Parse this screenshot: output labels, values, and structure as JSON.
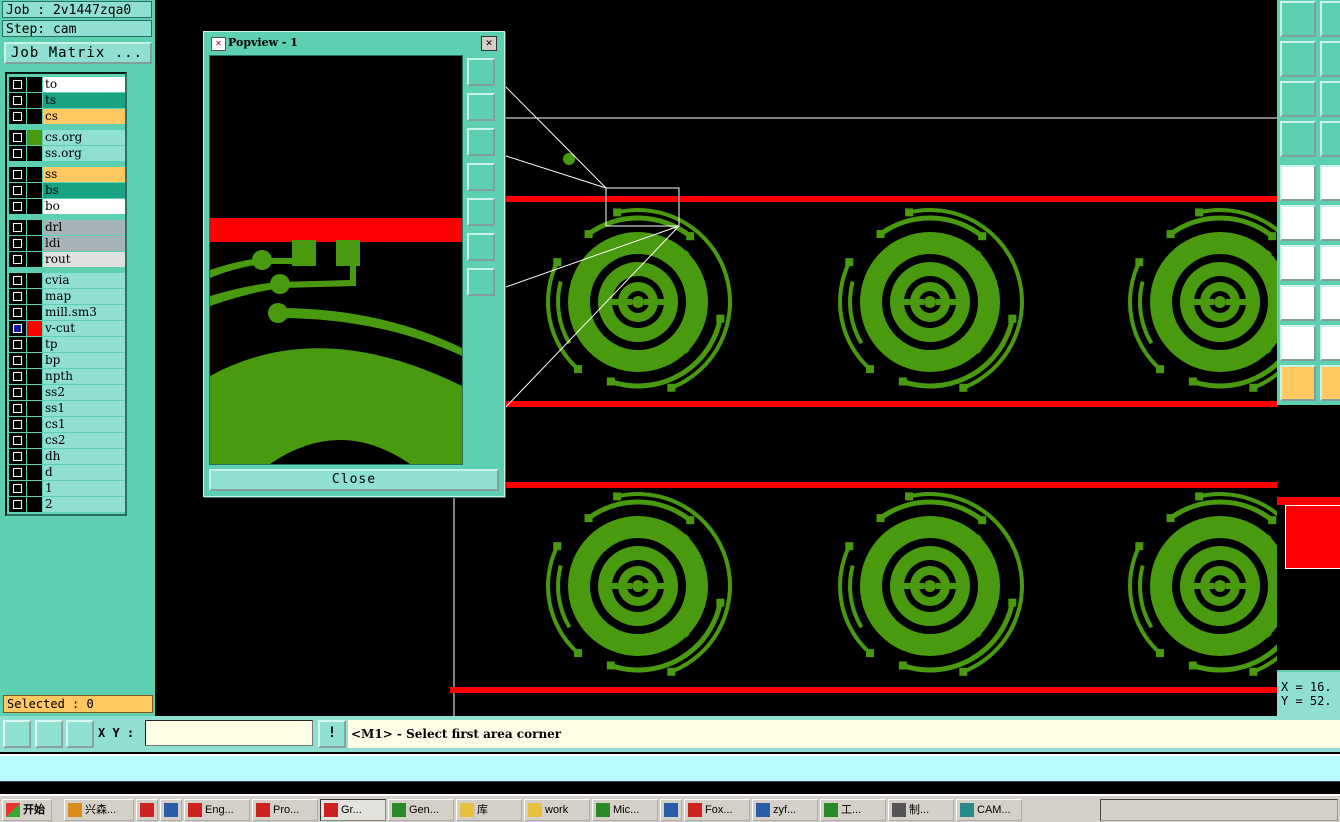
{
  "job": {
    "label": "Job : 2v1447zqa0",
    "step": "Step: cam",
    "matrix_button": "Job Matrix ..."
  },
  "layers": [
    {
      "name": "to",
      "color": "#ffffff"
    },
    {
      "name": "ts",
      "color": "#1aa383"
    },
    {
      "name": "cs",
      "color": "#ffc860"
    },
    {
      "name": "cs.org",
      "color": "#8fe0d2",
      "swatch": "#4a9a10"
    },
    {
      "name": "ss.org",
      "color": "#8fe0d2"
    },
    {
      "name": "ss",
      "color": "#ffc860"
    },
    {
      "name": "bs",
      "color": "#1aa383"
    },
    {
      "name": "bo",
      "color": "#ffffff"
    },
    {
      "name": "drl",
      "color": "#a6b4b8"
    },
    {
      "name": "ldi",
      "color": "#a6b4b8"
    },
    {
      "name": "rout",
      "color": "#e0e0e0"
    },
    {
      "name": "cvia",
      "color": "#8fe0d2"
    },
    {
      "name": "map",
      "color": "#8fe0d2"
    },
    {
      "name": "mill.sm3",
      "color": "#8fe0d2"
    },
    {
      "name": "v-cut",
      "color": "#8fe0d2",
      "swatch": "#ff0000",
      "on": true
    },
    {
      "name": "tp",
      "color": "#8fe0d2"
    },
    {
      "name": "bp",
      "color": "#8fe0d2"
    },
    {
      "name": "npth",
      "color": "#8fe0d2"
    },
    {
      "name": "ss2",
      "color": "#8fe0d2"
    },
    {
      "name": "ss1",
      "color": "#8fe0d2"
    },
    {
      "name": "cs1",
      "color": "#8fe0d2"
    },
    {
      "name": "cs2",
      "color": "#8fe0d2"
    },
    {
      "name": "dh",
      "color": "#8fe0d2"
    },
    {
      "name": "d",
      "color": "#8fe0d2"
    },
    {
      "name": "1",
      "color": "#8fe0d2"
    },
    {
      "name": "2",
      "color": "#8fe0d2"
    }
  ],
  "selected": "Selected : 0",
  "popview": {
    "title": "Popview - 1",
    "close_label": "Close"
  },
  "coords": {
    "x": "X = 16.",
    "y": "Y = 52."
  },
  "command": {
    "xy_label": "X Y :",
    "xy_value": "",
    "message": "<M1> - Select first area corner"
  },
  "taskbar": {
    "start": "开始",
    "tasks": [
      {
        "label": "兴森...",
        "icon": "#d98c1a"
      },
      {
        "label": "",
        "icon": "#c22"
      },
      {
        "label": "",
        "icon": "#2a5ca8"
      },
      {
        "label": "Eng...",
        "icon": "#c22"
      },
      {
        "label": "Pro...",
        "icon": "#c22"
      },
      {
        "label": "Gr...",
        "icon": "#c22",
        "active": true
      },
      {
        "label": "Gen...",
        "icon": "#2a8a2a"
      },
      {
        "label": "库",
        "icon": "#e8c040"
      },
      {
        "label": "work",
        "icon": "#e8c040"
      },
      {
        "label": "Mic...",
        "icon": "#2a8a2a"
      },
      {
        "label": "",
        "icon": "#2a5ca8"
      },
      {
        "label": "Fox...",
        "icon": "#c22"
      },
      {
        "label": "zyf...",
        "icon": "#2a5ca8"
      },
      {
        "label": "工...",
        "icon": "#2a8a2a"
      },
      {
        "label": "制...",
        "icon": "#555"
      },
      {
        "label": "CAM...",
        "icon": "#2a8a8a"
      }
    ]
  },
  "colors": {
    "board_green": "#4a9a10",
    "vcut_red": "#ff0000",
    "panel": "#5ed0b2"
  }
}
